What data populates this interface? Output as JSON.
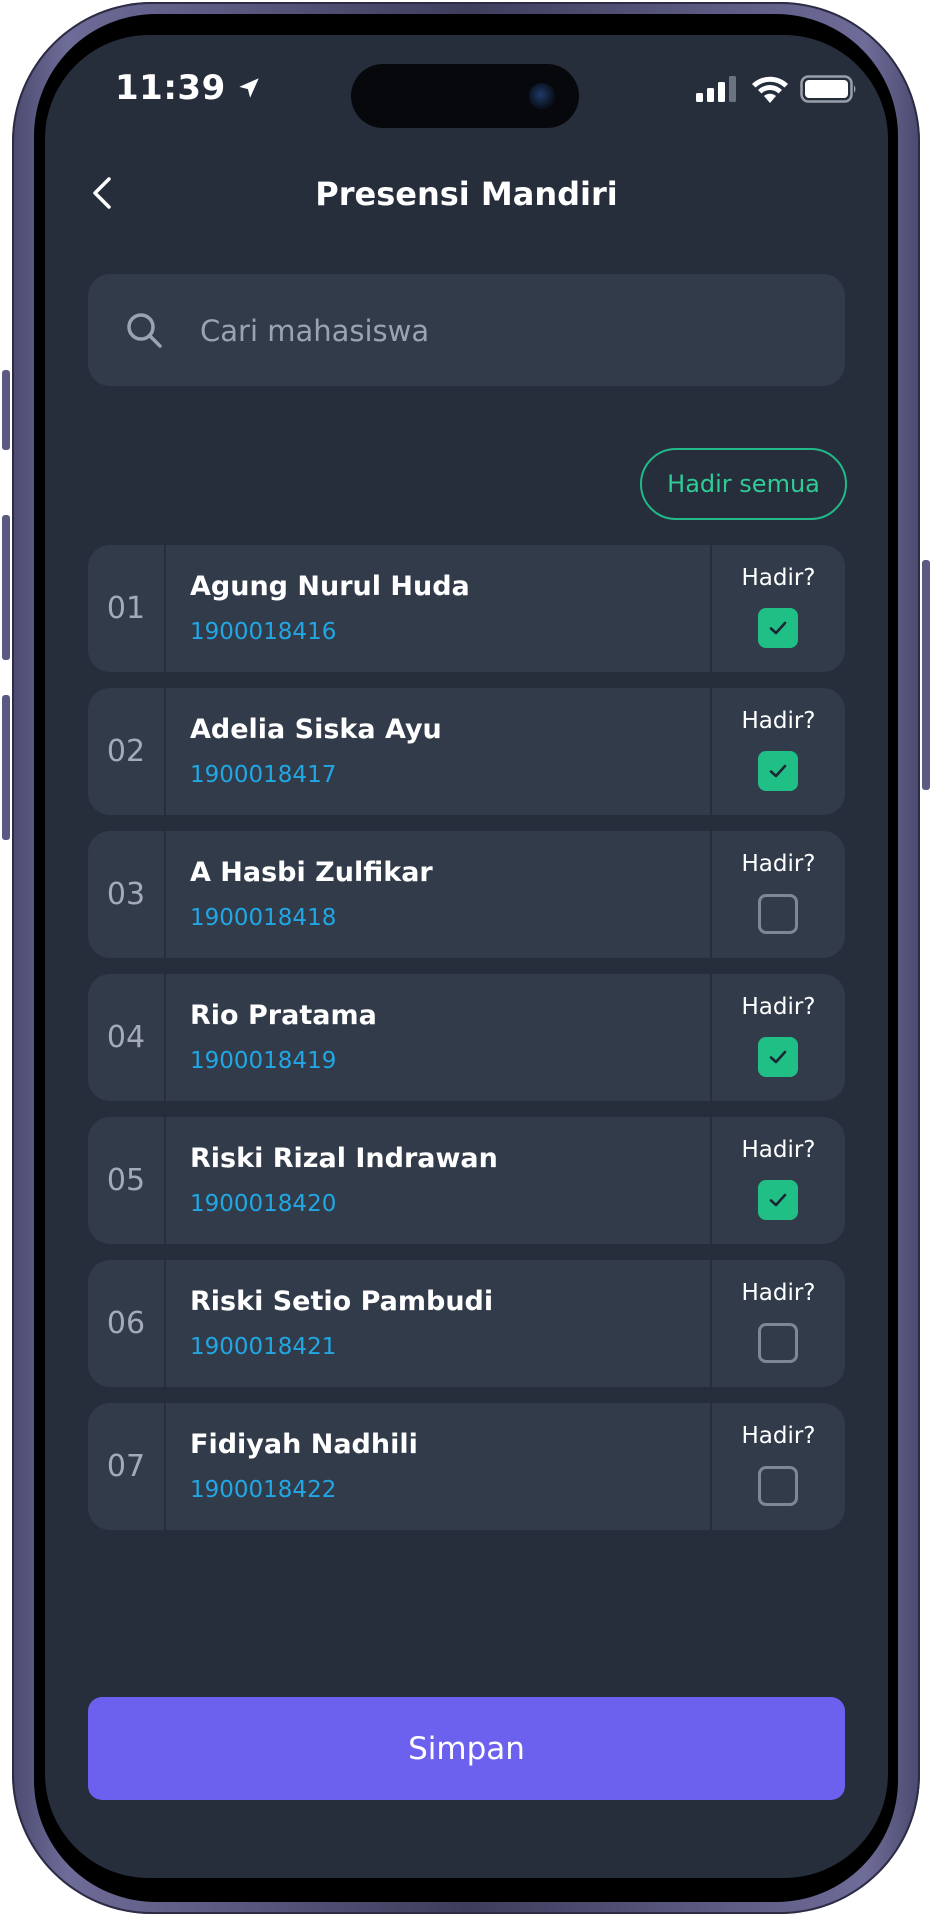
{
  "status_bar": {
    "time": "11:39",
    "icons": [
      "location-arrow-icon",
      "signal-icon",
      "wifi-icon",
      "battery-icon"
    ]
  },
  "header": {
    "title": "Presensi Mandiri",
    "back_icon": "chevron-left-icon"
  },
  "search": {
    "icon": "search-icon",
    "placeholder": "Cari mahasiswa",
    "value": ""
  },
  "actions": {
    "mark_all_label": "Hadir semua"
  },
  "students": [
    {
      "no": "01",
      "name": "Agung Nurul Huda",
      "nim": "1900018416",
      "hadir_label": "Hadir?",
      "present": true
    },
    {
      "no": "02",
      "name": "Adelia Siska Ayu",
      "nim": "1900018417",
      "hadir_label": "Hadir?",
      "present": true
    },
    {
      "no": "03",
      "name": "A Hasbi Zulfikar",
      "nim": "1900018418",
      "hadir_label": "Hadir?",
      "present": false
    },
    {
      "no": "04",
      "name": "Rio Pratama",
      "nim": "1900018419",
      "hadir_label": "Hadir?",
      "present": true
    },
    {
      "no": "05",
      "name": "Riski Rizal Indrawan",
      "nim": "1900018420",
      "hadir_label": "Hadir?",
      "present": true
    },
    {
      "no": "06",
      "name": "Riski Setio Pambudi",
      "nim": "1900018421",
      "hadir_label": "Hadir?",
      "present": false
    },
    {
      "no": "07",
      "name": "Fidiyah Nadhili",
      "nim": "1900018422",
      "hadir_label": "Hadir?",
      "present": false
    }
  ],
  "footer": {
    "save_label": "Simpan"
  },
  "colors": {
    "background": "#262d3b",
    "card": "#323b4a",
    "accent_green": "#1fbf86",
    "nim_blue": "#21a7e3",
    "primary_button": "#6b61ee"
  }
}
